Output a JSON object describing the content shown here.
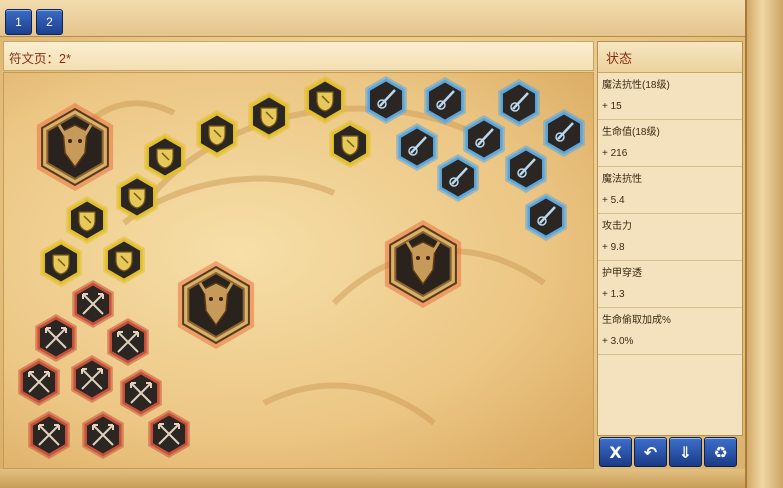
{
  "tabs": [
    {
      "label": "1"
    },
    {
      "label": "2"
    }
  ],
  "page_title": "符文页：2*",
  "stats": {
    "title": "状态",
    "items": [
      {
        "name": "魔法抗性(18级)",
        "value": "+ 15"
      },
      {
        "name": "生命值(18级)",
        "value": "+ 216"
      },
      {
        "name": "魔法抗性",
        "value": "+ 5.4"
      },
      {
        "name": "攻击力",
        "value": "+ 9.8"
      },
      {
        "name": "护甲穿透",
        "value": "+ 1.3"
      },
      {
        "name": "生命偷取加成%",
        "value": "+ 3.0%"
      }
    ]
  },
  "buttons": {
    "clear": "X",
    "undo": "↶",
    "save": "⇓",
    "recycle": "♻"
  },
  "runes": {
    "quintessence": {
      "count": 3,
      "icon": "dragon-face-icon"
    },
    "mark": {
      "count": 9,
      "color": "#c8513a",
      "icon": "crossed-arrows-icon"
    },
    "seal": {
      "count": 9,
      "color": "#e2c02a",
      "icon": "shield-icon"
    },
    "glyph": {
      "count": 9,
      "color": "#5aa7e0",
      "icon": "sword-swirl-icon"
    }
  }
}
